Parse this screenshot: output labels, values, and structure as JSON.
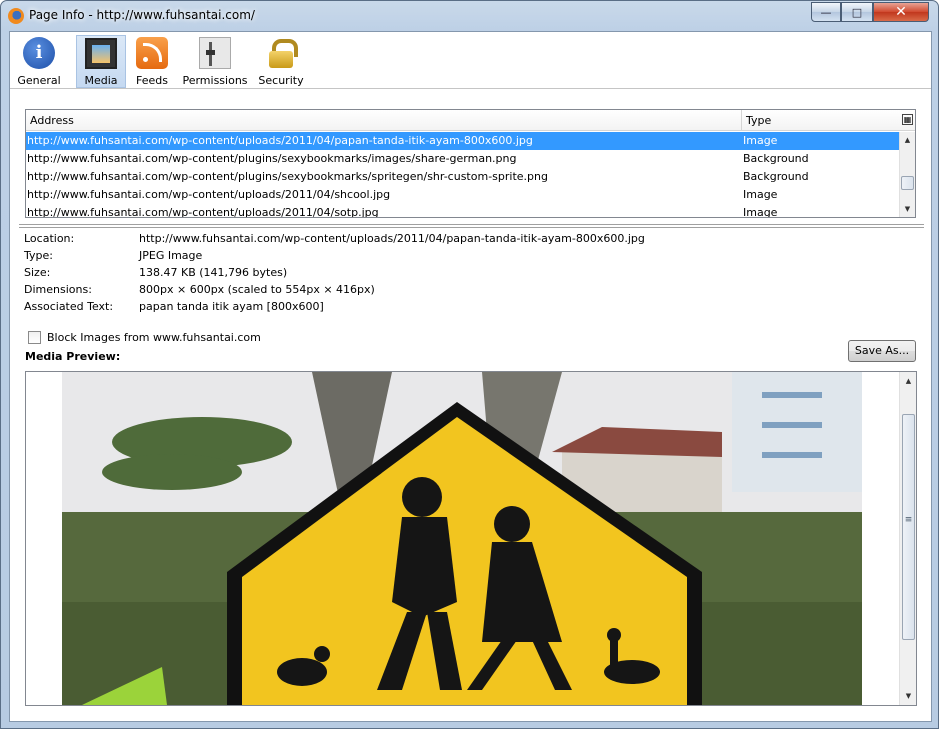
{
  "window": {
    "title": "Page Info - http://www.fuhsantai.com/",
    "minimize_glyph": "—",
    "maximize_glyph": "□",
    "close_glyph": "✕"
  },
  "toolbar": {
    "tabs": [
      {
        "label": "General",
        "icon": "info-icon",
        "glyph": "i"
      },
      {
        "label": "Media",
        "icon": "media-icon",
        "selected": true
      },
      {
        "label": "Feeds",
        "icon": "rss-icon"
      },
      {
        "label": "Permissions",
        "icon": "permissions-icon"
      },
      {
        "label": "Security",
        "icon": "lock-icon"
      }
    ]
  },
  "media_list": {
    "columns": [
      "Address",
      "Type"
    ],
    "column_picker_glyph": "▦",
    "rows": [
      {
        "address": "http://www.fuhsantai.com/wp-content/uploads/2011/04/papan-tanda-itik-ayam-800x600.jpg",
        "type": "Image",
        "selected": true
      },
      {
        "address": "http://www.fuhsantai.com/wp-content/plugins/sexybookmarks/images/share-german.png",
        "type": "Background"
      },
      {
        "address": "http://www.fuhsantai.com/wp-content/plugins/sexybookmarks/spritegen/shr-custom-sprite.png",
        "type": "Background"
      },
      {
        "address": "http://www.fuhsantai.com/wp-content/uploads/2011/04/shcool.jpg",
        "type": "Image"
      },
      {
        "address": "http://www.fuhsantai.com/wp-content/uploads/2011/04/sotp.jpg",
        "type": "Image"
      }
    ]
  },
  "details": {
    "location_label": "Location:",
    "location": "http://www.fuhsantai.com/wp-content/uploads/2011/04/papan-tanda-itik-ayam-800x600.jpg",
    "type_label": "Type:",
    "type": "JPEG Image",
    "size_label": "Size:",
    "size": "138.47 KB (141,796 bytes)",
    "dimensions_label": "Dimensions:",
    "dimensions": "800px × 600px (scaled to 554px × 416px)",
    "assoc_label": "Associated Text:",
    "assoc_text": "papan tanda itik ayam [800x600]"
  },
  "block_images_label": "Block Images from www.fuhsantai.com",
  "media_preview_label": "Media Preview:",
  "save_as_label": "Save As...",
  "scroll": {
    "up_glyph": "▲",
    "down_glyph": "▼",
    "grip_glyph": "≡"
  }
}
